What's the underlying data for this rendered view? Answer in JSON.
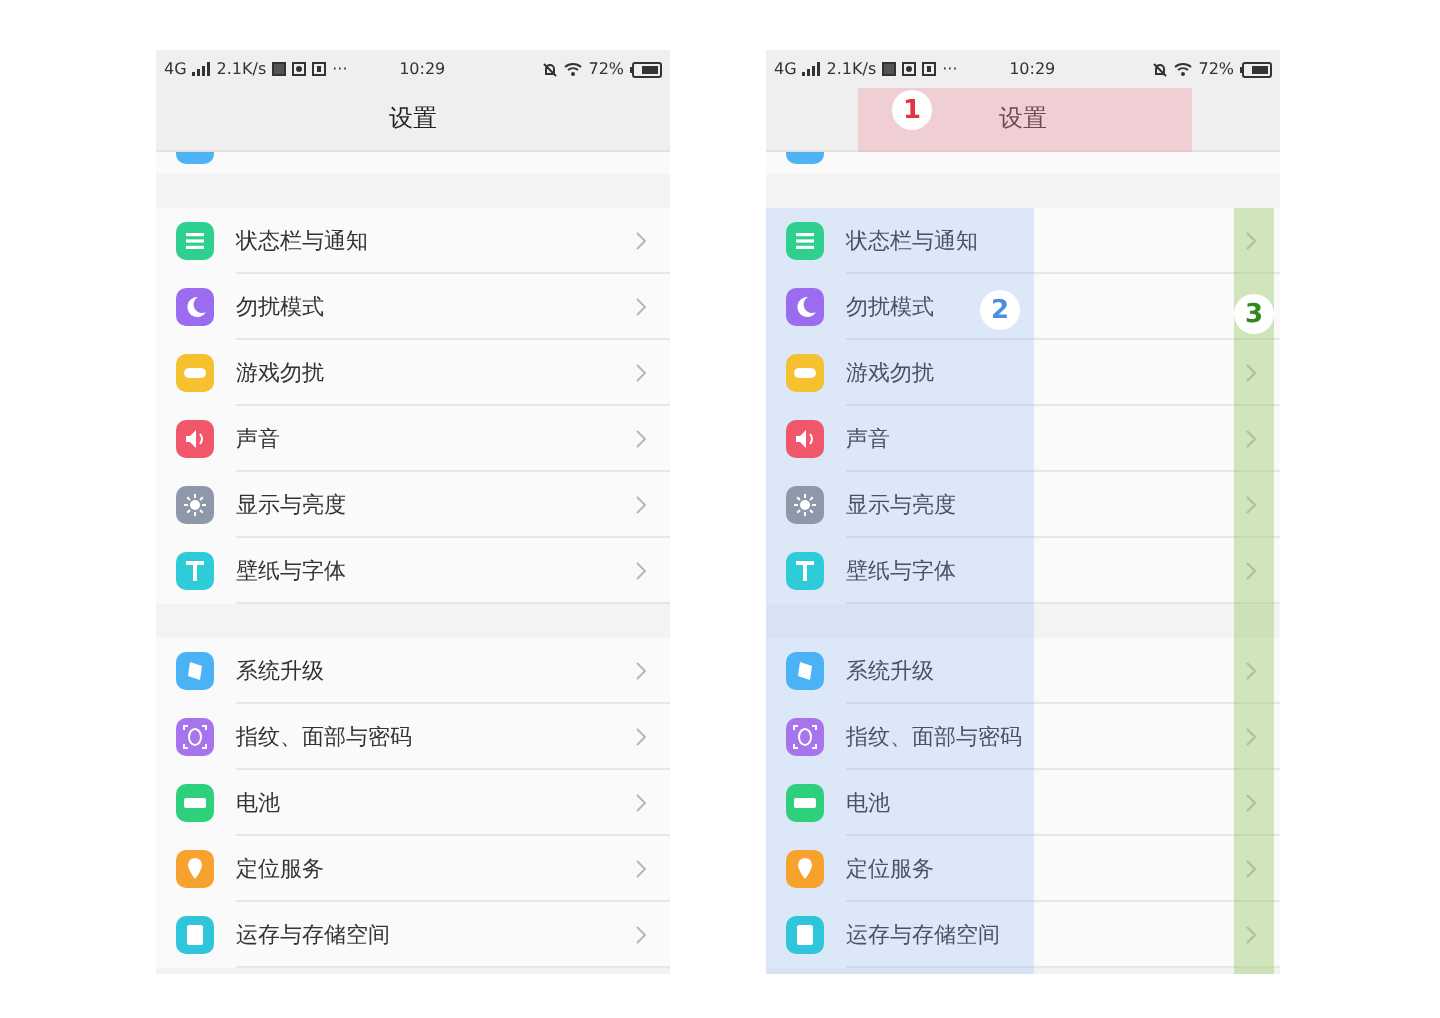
{
  "phones": [
    {
      "status_bar": {
        "network": "4G",
        "speed": "2.1K/s",
        "more": "···",
        "time": "10:29",
        "battery": "72%"
      },
      "title": "设置",
      "top_sliver": {
        "color": "#4db3f4"
      },
      "groups": [
        [
          {
            "label": "状态栏与通知",
            "color": "#2fd08e"
          },
          {
            "label": "勿扰模式",
            "color": "#9b6cf0"
          },
          {
            "label": "游戏勿扰",
            "color": "#f5c12e"
          },
          {
            "label": "声音",
            "color": "#f0576a"
          },
          {
            "label": "显示与亮度",
            "color": "#8e98a8"
          },
          {
            "label": "壁纸与字体",
            "color": "#2dccd8"
          }
        ],
        [
          {
            "label": "系统升级",
            "color": "#4cb2f6"
          },
          {
            "label": "指纹、面部与密码",
            "color": "#a874ee"
          },
          {
            "label": "电池",
            "color": "#2fd07c"
          },
          {
            "label": "定位服务",
            "color": "#f7a12e"
          },
          {
            "label": "运存与存储空间",
            "color": "#2fc6db"
          }
        ]
      ]
    },
    {
      "status_bar": {
        "network": "4G",
        "speed": "2.1K/s",
        "more": "···",
        "time": "10:29",
        "battery": "72%"
      },
      "title": "设置",
      "top_sliver": {
        "color": "#4db3f4"
      },
      "groups": [
        [
          {
            "label": "状态栏与通知",
            "color": "#2fd08e"
          },
          {
            "label": "勿扰模式",
            "color": "#9b6cf0"
          },
          {
            "label": "游戏勿扰",
            "color": "#f5c12e"
          },
          {
            "label": "声音",
            "color": "#f0576a"
          },
          {
            "label": "显示与亮度",
            "color": "#8e98a8"
          },
          {
            "label": "壁纸与字体",
            "color": "#2dccd8"
          }
        ],
        [
          {
            "label": "系统升级",
            "color": "#4cb2f6"
          },
          {
            "label": "指纹、面部与密码",
            "color": "#a874ee"
          },
          {
            "label": "电池",
            "color": "#2fd07c"
          },
          {
            "label": "定位服务",
            "color": "#f7a12e"
          },
          {
            "label": "运存与存储空间",
            "color": "#2fc6db"
          }
        ]
      ],
      "annotations": [
        {
          "kind": "title",
          "label": "1",
          "color": "#e2353d"
        },
        {
          "kind": "labels",
          "label": "2",
          "color": "#4a8fe0"
        },
        {
          "kind": "chevrons",
          "label": "3",
          "color": "#2f8a1e"
        }
      ]
    }
  ]
}
